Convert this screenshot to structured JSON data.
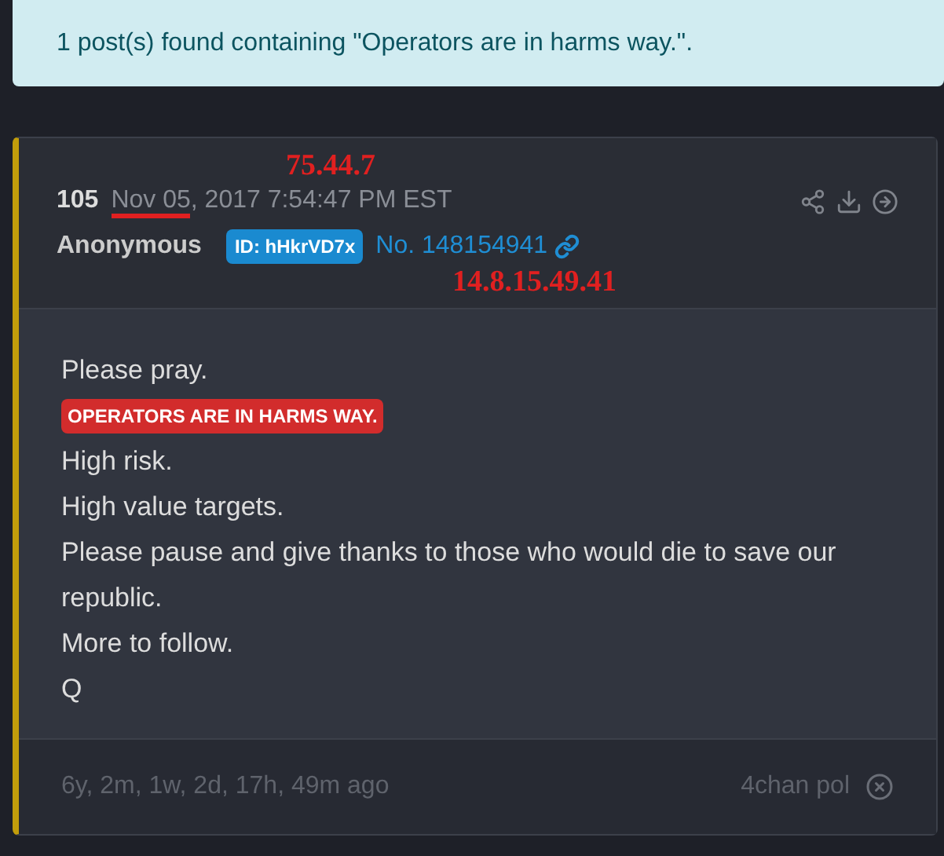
{
  "alert": {
    "text": "1 post(s) found containing \"Operators are in harms way.\"."
  },
  "post": {
    "number": "105",
    "date_underlined": "Nov 05",
    "date_rest": ", 2017 7:54:47 PM EST",
    "author": "Anonymous",
    "id_badge": "ID: hHkrVD7x",
    "post_no": "No. 148154941",
    "annotations": [
      {
        "text": "75.44.7"
      },
      {
        "text": "14.8.15.49.41"
      }
    ],
    "lines": [
      {
        "kind": "text",
        "text": "Please pray."
      },
      {
        "kind": "highlight",
        "text": "OPERATORS ARE IN HARMS WAY."
      },
      {
        "kind": "text",
        "text": "High risk."
      },
      {
        "kind": "text",
        "text": "High value targets."
      },
      {
        "kind": "text",
        "text": "Please pause and give thanks to those who would die to save our republic."
      },
      {
        "kind": "text",
        "text": "More to follow."
      },
      {
        "kind": "text",
        "text": "Q"
      }
    ],
    "age": "6y, 2m, 1w, 2d, 17h, 49m ago",
    "source": "4chan pol"
  }
}
